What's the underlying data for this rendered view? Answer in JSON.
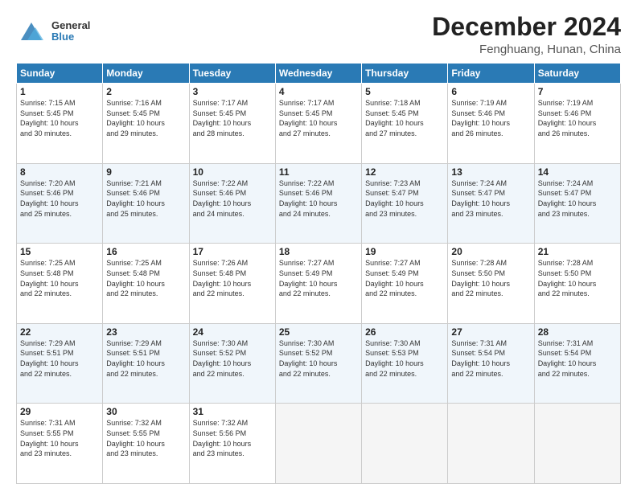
{
  "logo": {
    "general": "General",
    "blue": "Blue"
  },
  "title": "December 2024",
  "subtitle": "Fenghuang, Hunan, China",
  "days_header": [
    "Sunday",
    "Monday",
    "Tuesday",
    "Wednesday",
    "Thursday",
    "Friday",
    "Saturday"
  ],
  "weeks": [
    [
      {
        "day": "1",
        "info": "Sunrise: 7:15 AM\nSunset: 5:45 PM\nDaylight: 10 hours\nand 30 minutes."
      },
      {
        "day": "2",
        "info": "Sunrise: 7:16 AM\nSunset: 5:45 PM\nDaylight: 10 hours\nand 29 minutes."
      },
      {
        "day": "3",
        "info": "Sunrise: 7:17 AM\nSunset: 5:45 PM\nDaylight: 10 hours\nand 28 minutes."
      },
      {
        "day": "4",
        "info": "Sunrise: 7:17 AM\nSunset: 5:45 PM\nDaylight: 10 hours\nand 27 minutes."
      },
      {
        "day": "5",
        "info": "Sunrise: 7:18 AM\nSunset: 5:45 PM\nDaylight: 10 hours\nand 27 minutes."
      },
      {
        "day": "6",
        "info": "Sunrise: 7:19 AM\nSunset: 5:46 PM\nDaylight: 10 hours\nand 26 minutes."
      },
      {
        "day": "7",
        "info": "Sunrise: 7:19 AM\nSunset: 5:46 PM\nDaylight: 10 hours\nand 26 minutes."
      }
    ],
    [
      {
        "day": "8",
        "info": "Sunrise: 7:20 AM\nSunset: 5:46 PM\nDaylight: 10 hours\nand 25 minutes."
      },
      {
        "day": "9",
        "info": "Sunrise: 7:21 AM\nSunset: 5:46 PM\nDaylight: 10 hours\nand 25 minutes."
      },
      {
        "day": "10",
        "info": "Sunrise: 7:22 AM\nSunset: 5:46 PM\nDaylight: 10 hours\nand 24 minutes."
      },
      {
        "day": "11",
        "info": "Sunrise: 7:22 AM\nSunset: 5:46 PM\nDaylight: 10 hours\nand 24 minutes."
      },
      {
        "day": "12",
        "info": "Sunrise: 7:23 AM\nSunset: 5:47 PM\nDaylight: 10 hours\nand 23 minutes."
      },
      {
        "day": "13",
        "info": "Sunrise: 7:24 AM\nSunset: 5:47 PM\nDaylight: 10 hours\nand 23 minutes."
      },
      {
        "day": "14",
        "info": "Sunrise: 7:24 AM\nSunset: 5:47 PM\nDaylight: 10 hours\nand 23 minutes."
      }
    ],
    [
      {
        "day": "15",
        "info": "Sunrise: 7:25 AM\nSunset: 5:48 PM\nDaylight: 10 hours\nand 22 minutes."
      },
      {
        "day": "16",
        "info": "Sunrise: 7:25 AM\nSunset: 5:48 PM\nDaylight: 10 hours\nand 22 minutes."
      },
      {
        "day": "17",
        "info": "Sunrise: 7:26 AM\nSunset: 5:48 PM\nDaylight: 10 hours\nand 22 minutes."
      },
      {
        "day": "18",
        "info": "Sunrise: 7:27 AM\nSunset: 5:49 PM\nDaylight: 10 hours\nand 22 minutes."
      },
      {
        "day": "19",
        "info": "Sunrise: 7:27 AM\nSunset: 5:49 PM\nDaylight: 10 hours\nand 22 minutes."
      },
      {
        "day": "20",
        "info": "Sunrise: 7:28 AM\nSunset: 5:50 PM\nDaylight: 10 hours\nand 22 minutes."
      },
      {
        "day": "21",
        "info": "Sunrise: 7:28 AM\nSunset: 5:50 PM\nDaylight: 10 hours\nand 22 minutes."
      }
    ],
    [
      {
        "day": "22",
        "info": "Sunrise: 7:29 AM\nSunset: 5:51 PM\nDaylight: 10 hours\nand 22 minutes."
      },
      {
        "day": "23",
        "info": "Sunrise: 7:29 AM\nSunset: 5:51 PM\nDaylight: 10 hours\nand 22 minutes."
      },
      {
        "day": "24",
        "info": "Sunrise: 7:30 AM\nSunset: 5:52 PM\nDaylight: 10 hours\nand 22 minutes."
      },
      {
        "day": "25",
        "info": "Sunrise: 7:30 AM\nSunset: 5:52 PM\nDaylight: 10 hours\nand 22 minutes."
      },
      {
        "day": "26",
        "info": "Sunrise: 7:30 AM\nSunset: 5:53 PM\nDaylight: 10 hours\nand 22 minutes."
      },
      {
        "day": "27",
        "info": "Sunrise: 7:31 AM\nSunset: 5:54 PM\nDaylight: 10 hours\nand 22 minutes."
      },
      {
        "day": "28",
        "info": "Sunrise: 7:31 AM\nSunset: 5:54 PM\nDaylight: 10 hours\nand 22 minutes."
      }
    ],
    [
      {
        "day": "29",
        "info": "Sunrise: 7:31 AM\nSunset: 5:55 PM\nDaylight: 10 hours\nand 23 minutes."
      },
      {
        "day": "30",
        "info": "Sunrise: 7:32 AM\nSunset: 5:55 PM\nDaylight: 10 hours\nand 23 minutes."
      },
      {
        "day": "31",
        "info": "Sunrise: 7:32 AM\nSunset: 5:56 PM\nDaylight: 10 hours\nand 23 minutes."
      },
      {
        "day": "",
        "info": ""
      },
      {
        "day": "",
        "info": ""
      },
      {
        "day": "",
        "info": ""
      },
      {
        "day": "",
        "info": ""
      }
    ]
  ]
}
